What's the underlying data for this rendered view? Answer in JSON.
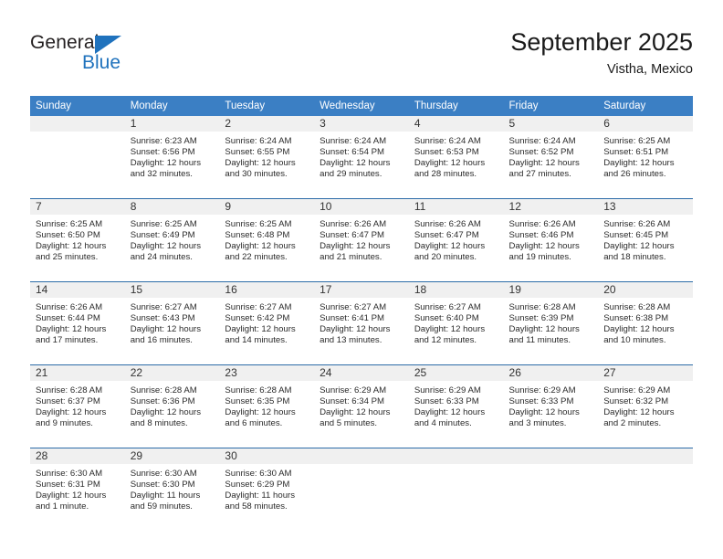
{
  "brand": {
    "word_one": "General",
    "word_two": "Blue",
    "triangle_color": "#1f72bd",
    "text_color": "#231f20",
    "icon": "general-blue-logo"
  },
  "header": {
    "title": "September 2025",
    "subtitle": "Vistha, Mexico"
  },
  "theme": {
    "header_row_bg": "#3b7fc4",
    "daynum_bg": "#f0f0f0",
    "row_divider": "#2d6ca8",
    "body_text": "#2b2b2b"
  },
  "columns": [
    "Sunday",
    "Monday",
    "Tuesday",
    "Wednesday",
    "Thursday",
    "Friday",
    "Saturday"
  ],
  "weeks": [
    [
      {
        "day": "",
        "empty": true,
        "sunrise": "",
        "sunset": "",
        "daylight_1": "",
        "daylight_2": ""
      },
      {
        "day": "1",
        "sunrise": "Sunrise: 6:23 AM",
        "sunset": "Sunset: 6:56 PM",
        "daylight_1": "Daylight: 12 hours",
        "daylight_2": "and 32 minutes."
      },
      {
        "day": "2",
        "sunrise": "Sunrise: 6:24 AM",
        "sunset": "Sunset: 6:55 PM",
        "daylight_1": "Daylight: 12 hours",
        "daylight_2": "and 30 minutes."
      },
      {
        "day": "3",
        "sunrise": "Sunrise: 6:24 AM",
        "sunset": "Sunset: 6:54 PM",
        "daylight_1": "Daylight: 12 hours",
        "daylight_2": "and 29 minutes."
      },
      {
        "day": "4",
        "sunrise": "Sunrise: 6:24 AM",
        "sunset": "Sunset: 6:53 PM",
        "daylight_1": "Daylight: 12 hours",
        "daylight_2": "and 28 minutes."
      },
      {
        "day": "5",
        "sunrise": "Sunrise: 6:24 AM",
        "sunset": "Sunset: 6:52 PM",
        "daylight_1": "Daylight: 12 hours",
        "daylight_2": "and 27 minutes."
      },
      {
        "day": "6",
        "sunrise": "Sunrise: 6:25 AM",
        "sunset": "Sunset: 6:51 PM",
        "daylight_1": "Daylight: 12 hours",
        "daylight_2": "and 26 minutes."
      }
    ],
    [
      {
        "day": "7",
        "sunrise": "Sunrise: 6:25 AM",
        "sunset": "Sunset: 6:50 PM",
        "daylight_1": "Daylight: 12 hours",
        "daylight_2": "and 25 minutes."
      },
      {
        "day": "8",
        "sunrise": "Sunrise: 6:25 AM",
        "sunset": "Sunset: 6:49 PM",
        "daylight_1": "Daylight: 12 hours",
        "daylight_2": "and 24 minutes."
      },
      {
        "day": "9",
        "sunrise": "Sunrise: 6:25 AM",
        "sunset": "Sunset: 6:48 PM",
        "daylight_1": "Daylight: 12 hours",
        "daylight_2": "and 22 minutes."
      },
      {
        "day": "10",
        "sunrise": "Sunrise: 6:26 AM",
        "sunset": "Sunset: 6:47 PM",
        "daylight_1": "Daylight: 12 hours",
        "daylight_2": "and 21 minutes."
      },
      {
        "day": "11",
        "sunrise": "Sunrise: 6:26 AM",
        "sunset": "Sunset: 6:47 PM",
        "daylight_1": "Daylight: 12 hours",
        "daylight_2": "and 20 minutes."
      },
      {
        "day": "12",
        "sunrise": "Sunrise: 6:26 AM",
        "sunset": "Sunset: 6:46 PM",
        "daylight_1": "Daylight: 12 hours",
        "daylight_2": "and 19 minutes."
      },
      {
        "day": "13",
        "sunrise": "Sunrise: 6:26 AM",
        "sunset": "Sunset: 6:45 PM",
        "daylight_1": "Daylight: 12 hours",
        "daylight_2": "and 18 minutes."
      }
    ],
    [
      {
        "day": "14",
        "sunrise": "Sunrise: 6:26 AM",
        "sunset": "Sunset: 6:44 PM",
        "daylight_1": "Daylight: 12 hours",
        "daylight_2": "and 17 minutes."
      },
      {
        "day": "15",
        "sunrise": "Sunrise: 6:27 AM",
        "sunset": "Sunset: 6:43 PM",
        "daylight_1": "Daylight: 12 hours",
        "daylight_2": "and 16 minutes."
      },
      {
        "day": "16",
        "sunrise": "Sunrise: 6:27 AM",
        "sunset": "Sunset: 6:42 PM",
        "daylight_1": "Daylight: 12 hours",
        "daylight_2": "and 14 minutes."
      },
      {
        "day": "17",
        "sunrise": "Sunrise: 6:27 AM",
        "sunset": "Sunset: 6:41 PM",
        "daylight_1": "Daylight: 12 hours",
        "daylight_2": "and 13 minutes."
      },
      {
        "day": "18",
        "sunrise": "Sunrise: 6:27 AM",
        "sunset": "Sunset: 6:40 PM",
        "daylight_1": "Daylight: 12 hours",
        "daylight_2": "and 12 minutes."
      },
      {
        "day": "19",
        "sunrise": "Sunrise: 6:28 AM",
        "sunset": "Sunset: 6:39 PM",
        "daylight_1": "Daylight: 12 hours",
        "daylight_2": "and 11 minutes."
      },
      {
        "day": "20",
        "sunrise": "Sunrise: 6:28 AM",
        "sunset": "Sunset: 6:38 PM",
        "daylight_1": "Daylight: 12 hours",
        "daylight_2": "and 10 minutes."
      }
    ],
    [
      {
        "day": "21",
        "sunrise": "Sunrise: 6:28 AM",
        "sunset": "Sunset: 6:37 PM",
        "daylight_1": "Daylight: 12 hours",
        "daylight_2": "and 9 minutes."
      },
      {
        "day": "22",
        "sunrise": "Sunrise: 6:28 AM",
        "sunset": "Sunset: 6:36 PM",
        "daylight_1": "Daylight: 12 hours",
        "daylight_2": "and 8 minutes."
      },
      {
        "day": "23",
        "sunrise": "Sunrise: 6:28 AM",
        "sunset": "Sunset: 6:35 PM",
        "daylight_1": "Daylight: 12 hours",
        "daylight_2": "and 6 minutes."
      },
      {
        "day": "24",
        "sunrise": "Sunrise: 6:29 AM",
        "sunset": "Sunset: 6:34 PM",
        "daylight_1": "Daylight: 12 hours",
        "daylight_2": "and 5 minutes."
      },
      {
        "day": "25",
        "sunrise": "Sunrise: 6:29 AM",
        "sunset": "Sunset: 6:33 PM",
        "daylight_1": "Daylight: 12 hours",
        "daylight_2": "and 4 minutes."
      },
      {
        "day": "26",
        "sunrise": "Sunrise: 6:29 AM",
        "sunset": "Sunset: 6:33 PM",
        "daylight_1": "Daylight: 12 hours",
        "daylight_2": "and 3 minutes."
      },
      {
        "day": "27",
        "sunrise": "Sunrise: 6:29 AM",
        "sunset": "Sunset: 6:32 PM",
        "daylight_1": "Daylight: 12 hours",
        "daylight_2": "and 2 minutes."
      }
    ],
    [
      {
        "day": "28",
        "sunrise": "Sunrise: 6:30 AM",
        "sunset": "Sunset: 6:31 PM",
        "daylight_1": "Daylight: 12 hours",
        "daylight_2": "and 1 minute."
      },
      {
        "day": "29",
        "sunrise": "Sunrise: 6:30 AM",
        "sunset": "Sunset: 6:30 PM",
        "daylight_1": "Daylight: 11 hours",
        "daylight_2": "and 59 minutes."
      },
      {
        "day": "30",
        "sunrise": "Sunrise: 6:30 AM",
        "sunset": "Sunset: 6:29 PM",
        "daylight_1": "Daylight: 11 hours",
        "daylight_2": "and 58 minutes."
      },
      {
        "day": "",
        "empty": true,
        "sunrise": "",
        "sunset": "",
        "daylight_1": "",
        "daylight_2": ""
      },
      {
        "day": "",
        "empty": true,
        "sunrise": "",
        "sunset": "",
        "daylight_1": "",
        "daylight_2": ""
      },
      {
        "day": "",
        "empty": true,
        "sunrise": "",
        "sunset": "",
        "daylight_1": "",
        "daylight_2": ""
      },
      {
        "day": "",
        "empty": true,
        "sunrise": "",
        "sunset": "",
        "daylight_1": "",
        "daylight_2": ""
      }
    ]
  ]
}
